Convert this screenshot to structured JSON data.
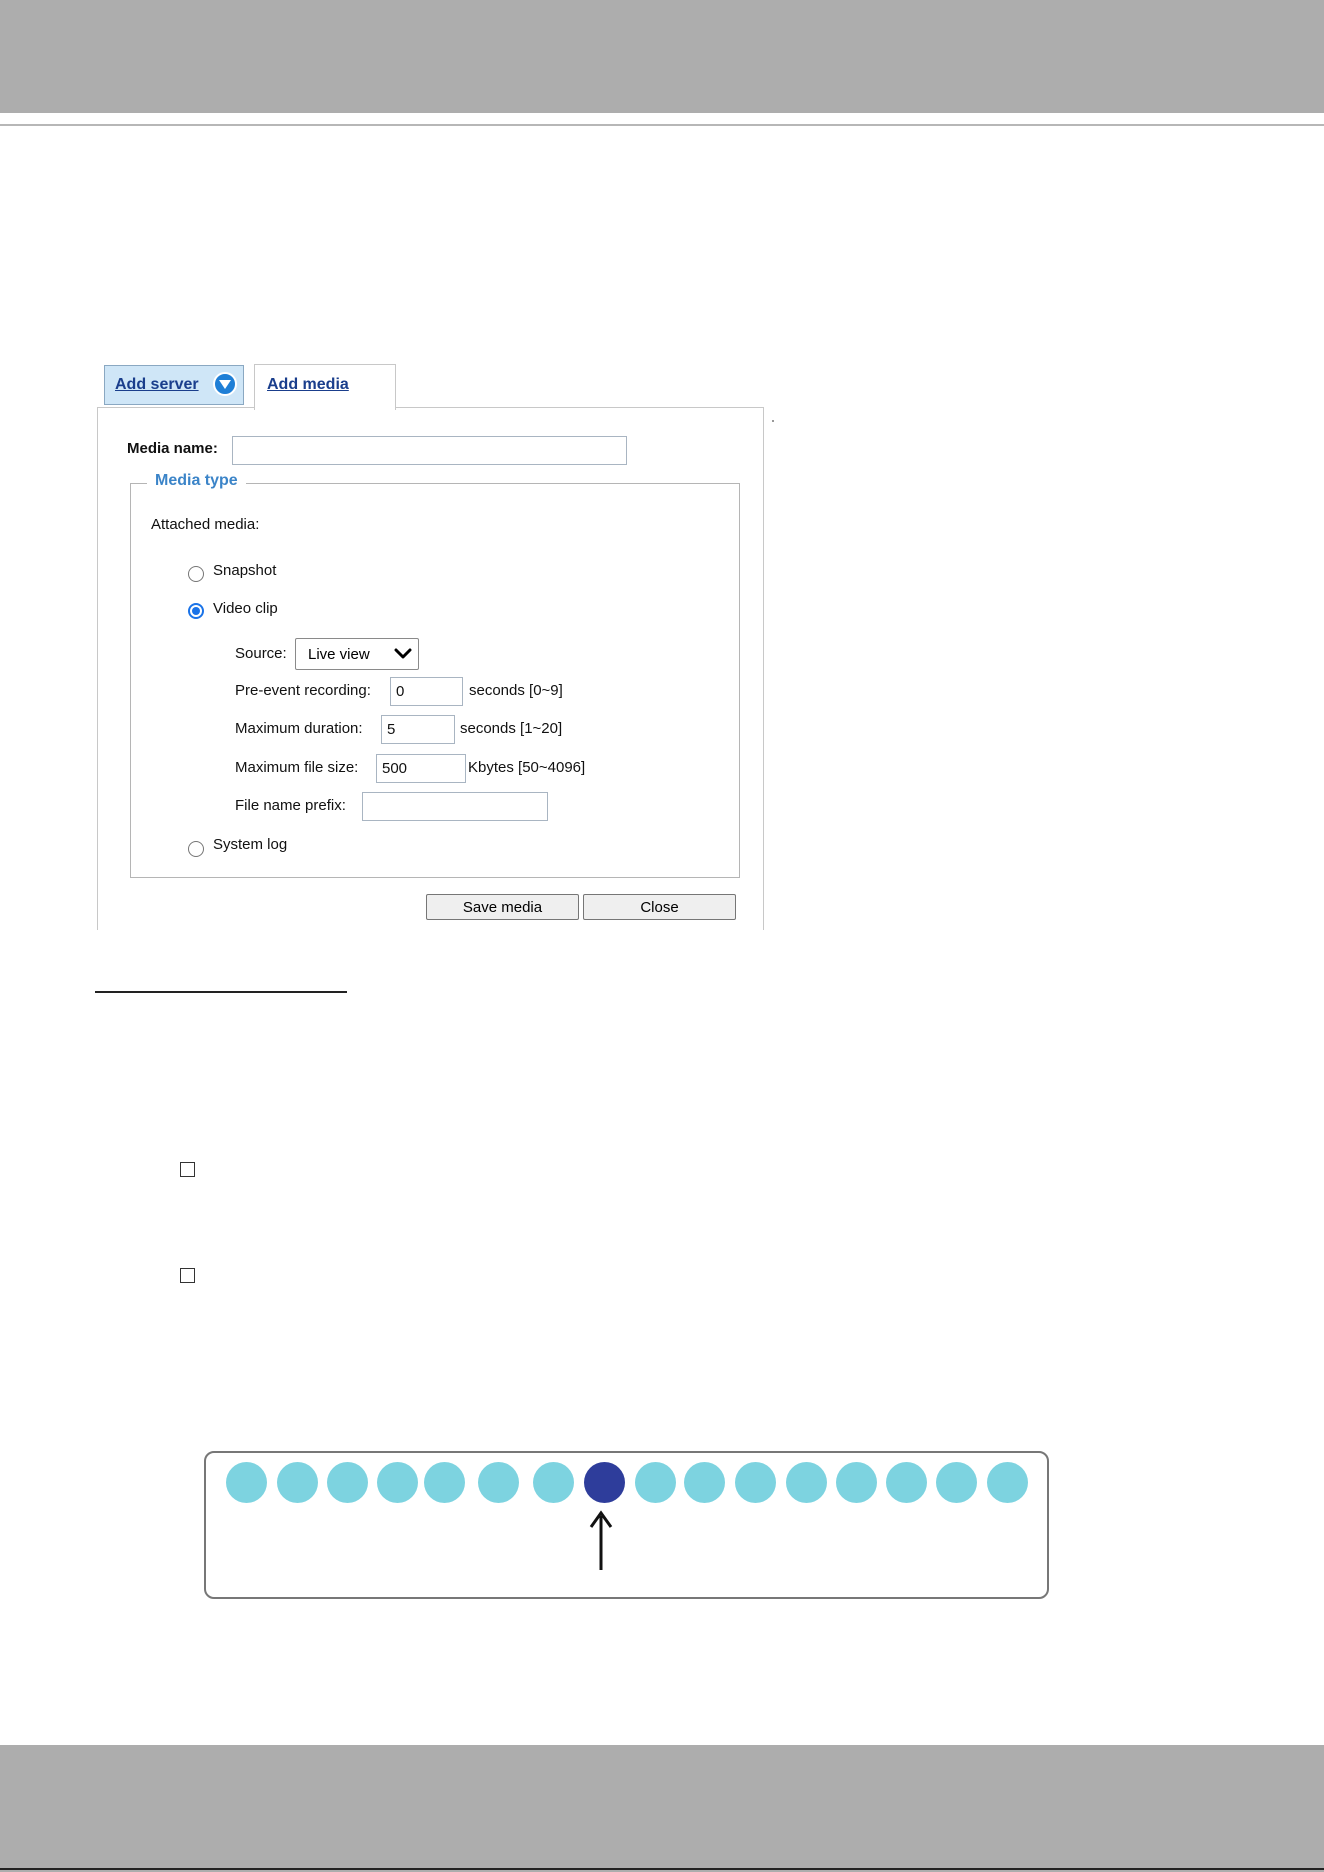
{
  "tabs": {
    "server_label": "Add server",
    "media_label": "Add media",
    "toggle_icon": "expand-down-icon"
  },
  "form": {
    "media_name_label": "Media name:",
    "media_name_value": "",
    "media_type_legend": "Media type",
    "attached_media_label": "Attached media:",
    "options": {
      "snapshot": "Snapshot",
      "video_clip": "Video clip",
      "system_log": "System log"
    },
    "selected_option": "video_clip",
    "video": {
      "source_label": "Source:",
      "source_value": "Live view",
      "pre_event_label": "Pre-event recording:",
      "pre_event_value": "0",
      "pre_event_unit": "seconds [0~9]",
      "max_duration_label": "Maximum duration:",
      "max_duration_value": "5",
      "max_duration_unit": "seconds [1~20]",
      "max_file_size_label": "Maximum file size:",
      "max_file_size_value": "500",
      "max_file_size_unit": "Kbytes [50~4096]",
      "prefix_label": "File name prefix:",
      "prefix_value": ""
    },
    "buttons": {
      "save": "Save media",
      "close": "Close"
    }
  },
  "checkboxes": [
    {
      "checked": false
    },
    {
      "checked": false
    }
  ],
  "sequence": {
    "count": 16,
    "highlighted_index": 7,
    "dot_color": "#7dd3e0",
    "highlight_color": "#2e3d9b"
  },
  "colors": {
    "header_gray": "#adadad",
    "link_blue": "#1a3e8c",
    "legend_blue": "#3b84c8"
  }
}
